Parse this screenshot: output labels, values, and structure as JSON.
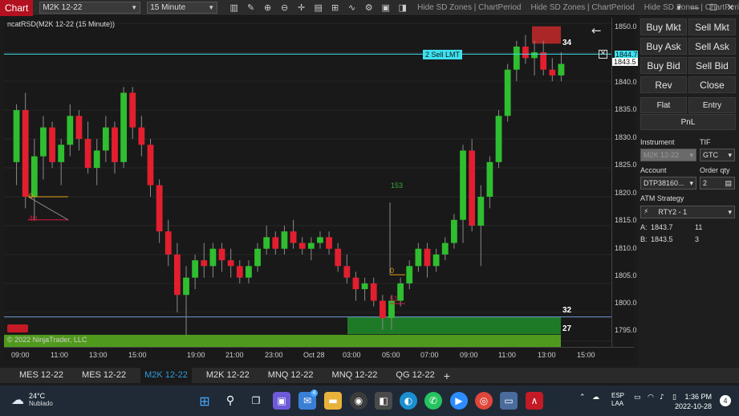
{
  "toolbar": {
    "app_tag": "Chart",
    "instrument": "M2K 12-22",
    "interval": "15 Minute",
    "links": [
      "Hide SD Zones | ChartPeriod",
      "Hide SD Zones | ChartPeriod",
      "Hide SD Zones | ChartPeri"
    ]
  },
  "chart": {
    "title": "ncatRSD(M2K 12-22 (15 Minute))",
    "copyright": "© 2022 NinjaTrader, LLC",
    "order_line_label": "2 Sell LMT",
    "order_line_price": "1844.7",
    "last_price": "1843.5",
    "zone_labels": [
      "34",
      "32",
      "27"
    ],
    "indicator_labels": [
      "0",
      "40",
      "153",
      "0",
      "51"
    ],
    "price_ticks": [
      "1850.0",
      "1845.0",
      "1840.0",
      "1835.0",
      "1830.0",
      "1825.0",
      "1820.0",
      "1815.0",
      "1810.0",
      "1805.0",
      "1800.0",
      "1795.0"
    ],
    "time_ticks": [
      "09:00",
      "11:00",
      "13:00",
      "15:00",
      "19:00",
      "21:00",
      "23:00",
      "Oct 28",
      "03:00",
      "05:00",
      "07:00",
      "09:00",
      "11:00",
      "13:00",
      "15:00"
    ]
  },
  "chart_data": {
    "type": "candlestick",
    "ylim": [
      1794,
      1851
    ],
    "candles": [
      [
        1826,
        1836,
        1822,
        1835
      ],
      [
        1835,
        1838,
        1818,
        1820
      ],
      [
        1820,
        1830,
        1816,
        1827
      ],
      [
        1827,
        1834,
        1823,
        1832
      ],
      [
        1832,
        1833,
        1825,
        1826
      ],
      [
        1826,
        1830,
        1822,
        1829
      ],
      [
        1829,
        1836,
        1827,
        1834
      ],
      [
        1834,
        1835,
        1828,
        1830
      ],
      [
        1830,
        1833,
        1824,
        1825
      ],
      [
        1825,
        1830,
        1822,
        1828
      ],
      [
        1828,
        1834,
        1826,
        1832
      ],
      [
        1832,
        1833,
        1824,
        1826
      ],
      [
        1826,
        1839,
        1825,
        1838
      ],
      [
        1838,
        1839,
        1830,
        1832
      ],
      [
        1832,
        1834,
        1827,
        1829
      ],
      [
        1829,
        1830,
        1820,
        1822
      ],
      [
        1822,
        1823,
        1812,
        1814
      ],
      [
        1814,
        1816,
        1808,
        1810
      ],
      [
        1810,
        1812,
        1800,
        1803
      ],
      [
        1803,
        1808,
        1796,
        1806
      ],
      [
        1806,
        1810,
        1804,
        1809
      ],
      [
        1809,
        1812,
        1806,
        1808
      ],
      [
        1808,
        1812,
        1806,
        1811
      ],
      [
        1811,
        1812,
        1807,
        1809
      ],
      [
        1809,
        1811,
        1806,
        1808
      ],
      [
        1808,
        1809,
        1805,
        1806
      ],
      [
        1806,
        1809,
        1805,
        1808
      ],
      [
        1808,
        1812,
        1807,
        1811
      ],
      [
        1811,
        1815,
        1810,
        1813
      ],
      [
        1813,
        1814,
        1810,
        1811
      ],
      [
        1811,
        1815,
        1810,
        1814
      ],
      [
        1814,
        1816,
        1811,
        1812
      ],
      [
        1812,
        1813,
        1810,
        1811
      ],
      [
        1811,
        1813,
        1809,
        1812
      ],
      [
        1812,
        1814,
        1811,
        1813
      ],
      [
        1813,
        1814,
        1810,
        1811
      ],
      [
        1811,
        1812,
        1807,
        1808
      ],
      [
        1808,
        1810,
        1805,
        1806
      ],
      [
        1806,
        1807,
        1802,
        1804
      ],
      [
        1804,
        1806,
        1802,
        1805
      ],
      [
        1805,
        1806,
        1801,
        1802
      ],
      [
        1802,
        1803,
        1797,
        1799
      ],
      [
        1799,
        1803,
        1797,
        1802
      ],
      [
        1802,
        1806,
        1801,
        1805
      ],
      [
        1805,
        1809,
        1804,
        1808
      ],
      [
        1808,
        1812,
        1807,
        1811
      ],
      [
        1811,
        1812,
        1806,
        1808
      ],
      [
        1808,
        1811,
        1807,
        1810
      ],
      [
        1810,
        1813,
        1809,
        1812
      ],
      [
        1812,
        1817,
        1811,
        1816
      ],
      [
        1816,
        1829,
        1812,
        1828
      ],
      [
        1828,
        1830,
        1814,
        1815
      ],
      [
        1815,
        1822,
        1808,
        1820
      ],
      [
        1820,
        1827,
        1818,
        1826
      ],
      [
        1826,
        1835,
        1825,
        1834
      ],
      [
        1834,
        1843,
        1833,
        1842
      ],
      [
        1842,
        1847,
        1840,
        1846
      ],
      [
        1846,
        1848,
        1843,
        1844
      ],
      [
        1844,
        1847,
        1841,
        1845
      ],
      [
        1845,
        1847,
        1841,
        1842
      ],
      [
        1842,
        1844,
        1840,
        1841
      ],
      [
        1841,
        1845,
        1840,
        1843
      ]
    ]
  },
  "side": {
    "buttons": [
      "Buy Mkt",
      "Sell Mkt",
      "Buy Ask",
      "Sell Ask",
      "Buy Bid",
      "Sell Bid",
      "Rev",
      "Close"
    ],
    "flat": "Flat",
    "entry": "Entry",
    "pnl": "PnL",
    "instrument_label": "Instrument",
    "instrument_value": "M2K 12-22",
    "tif_label": "TIF",
    "tif_value": "GTC",
    "account_label": "Account",
    "account_value": "DTP38160...",
    "qty_label": "Order qty",
    "qty_value": "2",
    "atm_label": "ATM Strategy",
    "atm_value": "RTY2 - 1",
    "ask_label": "A:",
    "ask_price": "1843.7",
    "ask_size": "11",
    "bid_label": "B:",
    "bid_price": "1843.5",
    "bid_size": "3"
  },
  "tabs": [
    "MES 12-22",
    "MES 12-22",
    "M2K 12-22",
    "M2K 12-22",
    "MNQ 12-22",
    "MNQ 12-22",
    "QG 12-22"
  ],
  "taskbar": {
    "temp": "24°C",
    "weather": "Nublado",
    "lang1": "ESP",
    "lang2": "LAA",
    "time": "1:36 PM",
    "date": "2022-10-28",
    "notifications": "4",
    "mail_badge": "4"
  }
}
